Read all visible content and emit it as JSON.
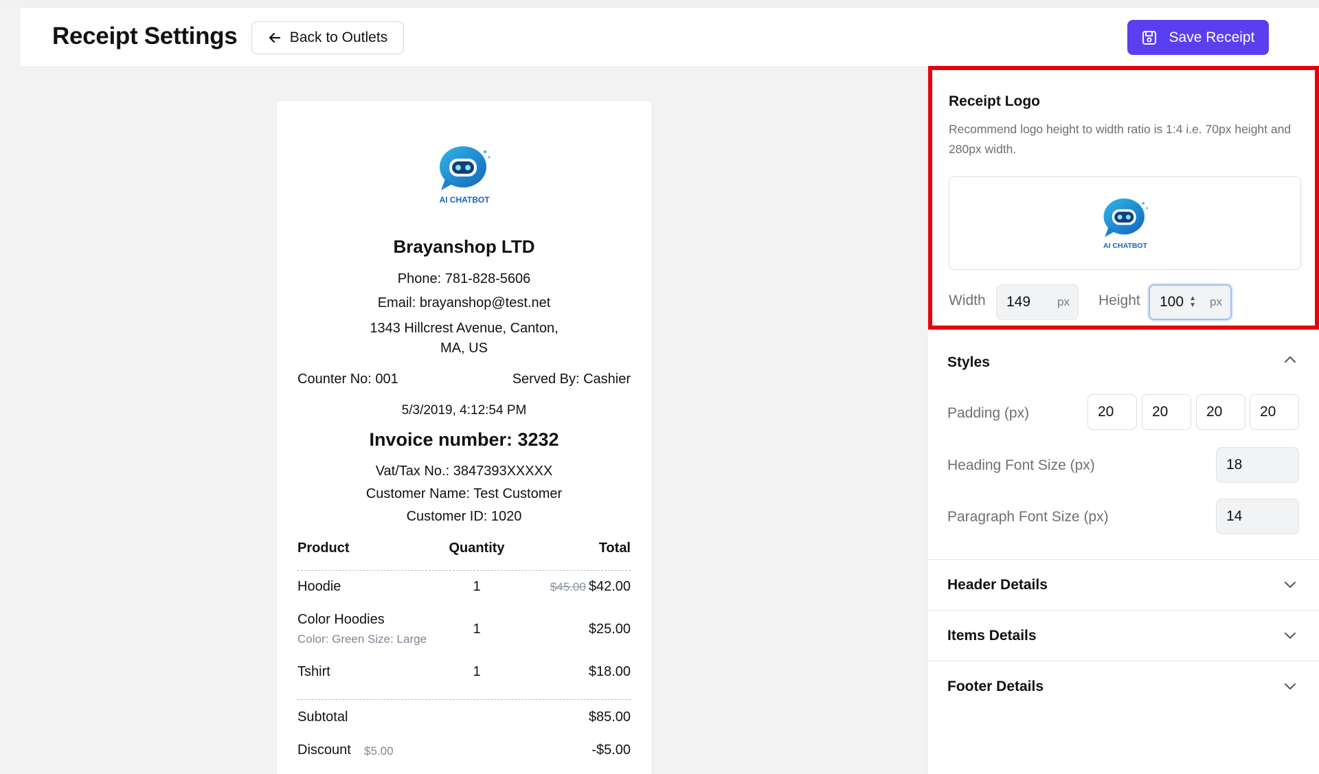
{
  "header": {
    "title": "Receipt Settings",
    "back_label": "Back to Outlets",
    "save_label": "Save Receipt"
  },
  "colors": {
    "accent": "#5a3ff0",
    "highlight": "#e8000b"
  },
  "receipt": {
    "logo_text": "AI CHATBOT",
    "shop_name": "Brayanshop LTD",
    "phone": "Phone: 781-828-5606",
    "email": "Email: brayanshop@test.net",
    "address_line1": "1343 Hillcrest Avenue, Canton,",
    "address_line2": "MA, US",
    "counter": "Counter No: 001",
    "served_by": "Served By: Cashier",
    "datetime": "5/3/2019, 4:12:54 PM",
    "invoice": "Invoice number: 3232",
    "vat": "Vat/Tax No.: 3847393XXXXX",
    "customer_name": "Customer Name: Test Customer",
    "customer_id": "Customer ID: 1020",
    "columns": {
      "product": "Product",
      "quantity": "Quantity",
      "total": "Total"
    },
    "items": [
      {
        "name": "Hoodie",
        "variant": "",
        "qty": "1",
        "old_price": "$45.00",
        "total": "$42.00"
      },
      {
        "name": "Color Hoodies",
        "variant": "Color: Green  Size: Large",
        "qty": "1",
        "old_price": "",
        "total": "$25.00"
      },
      {
        "name": "Tshirt",
        "variant": "",
        "qty": "1",
        "old_price": "",
        "total": "$18.00"
      }
    ],
    "subtotal_label": "Subtotal",
    "subtotal": "$85.00",
    "discount_label": "Discount",
    "discount_note": "$5.00",
    "discount": "-$5.00"
  },
  "logo_panel": {
    "title": "Receipt Logo",
    "description": "Recommend logo height to width ratio is 1:4 i.e. 70px height and 280px width.",
    "width_label": "Width",
    "width_value": "149",
    "height_label": "Height",
    "height_value": "100",
    "unit": "px"
  },
  "styles": {
    "title": "Styles",
    "padding_label": "Padding (px)",
    "padding": [
      "20",
      "20",
      "20",
      "20"
    ],
    "heading_font_label": "Heading Font Size (px)",
    "heading_font": "18",
    "paragraph_font_label": "Paragraph Font Size (px)",
    "paragraph_font": "14"
  },
  "sections": {
    "header_details": "Header Details",
    "items_details": "Items Details",
    "footer_details": "Footer Details"
  },
  "icons": [
    "arrow-left-icon",
    "save-icon",
    "chevron-up-icon",
    "chevron-down-icon",
    "robot-logo-icon"
  ]
}
